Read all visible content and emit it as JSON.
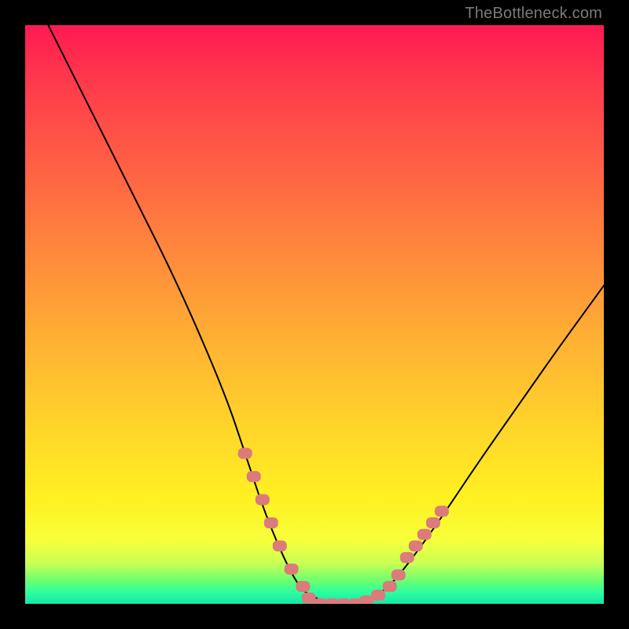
{
  "watermark": "TheBottleneck.com",
  "chart_data": {
    "type": "line",
    "title": "",
    "xlabel": "",
    "ylabel": "",
    "xlim": [
      0,
      100
    ],
    "ylim": [
      0,
      100
    ],
    "grid": false,
    "legend": false,
    "series": [
      {
        "name": "curve",
        "color": "#000000",
        "x": [
          4,
          10,
          15,
          20,
          25,
          30,
          35,
          38,
          42,
          47,
          50,
          53,
          57,
          60,
          63,
          67,
          72,
          78,
          85,
          92,
          100
        ],
        "y": [
          100,
          88,
          78,
          68,
          58,
          47,
          35,
          26,
          14,
          3,
          1,
          0,
          0,
          1,
          3,
          8,
          15,
          24,
          34,
          44,
          55
        ]
      },
      {
        "name": "left-dots",
        "color": "#db7b7b",
        "type": "scatter",
        "x": [
          38,
          39.5,
          41,
          42.5,
          44,
          46,
          48
        ],
        "y": [
          26,
          22,
          18,
          14,
          10,
          6,
          3
        ]
      },
      {
        "name": "bottom-dots",
        "color": "#db7b7b",
        "type": "scatter",
        "x": [
          49,
          51,
          53,
          55,
          57,
          59,
          61
        ],
        "y": [
          1,
          0,
          0,
          0,
          0,
          0.5,
          1.5
        ]
      },
      {
        "name": "right-dots",
        "color": "#db7b7b",
        "type": "scatter",
        "x": [
          63,
          64.5,
          66,
          67.5,
          69,
          70.5,
          72
        ],
        "y": [
          3,
          5,
          8,
          10,
          12,
          14,
          16
        ]
      }
    ]
  }
}
